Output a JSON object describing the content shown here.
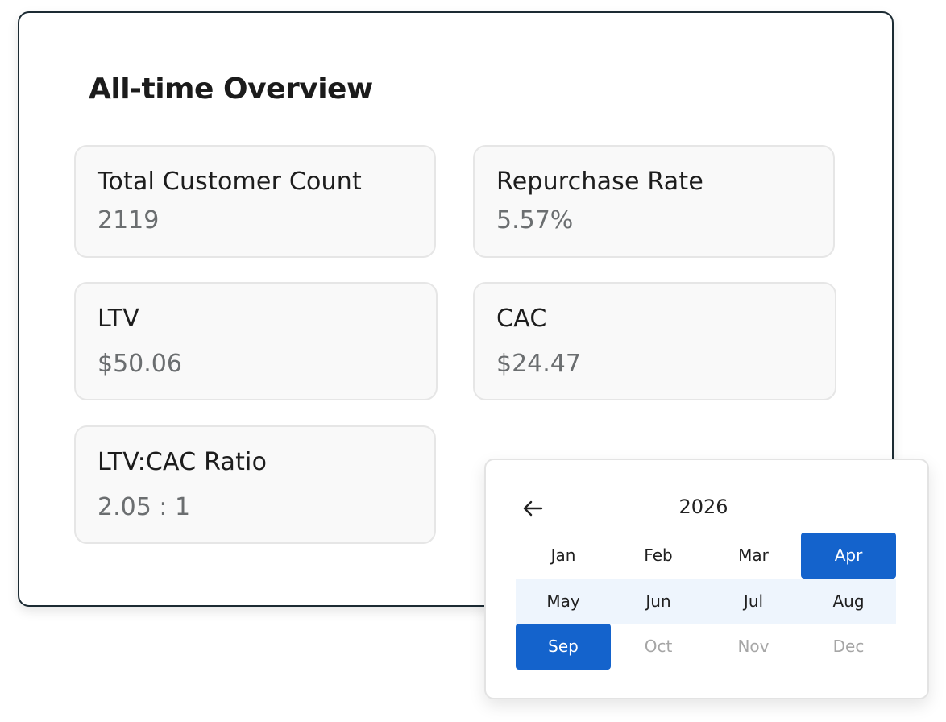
{
  "overview": {
    "title": "All-time Overview",
    "metrics": [
      {
        "label": "Total Customer Count",
        "value": "2119"
      },
      {
        "label": "Repurchase Rate",
        "value": "5.57%"
      },
      {
        "label": "LTV",
        "value": "$50.06"
      },
      {
        "label": "CAC",
        "value": "$24.47"
      },
      {
        "label": "LTV:CAC Ratio",
        "value": "2.05 : 1"
      }
    ]
  },
  "picker": {
    "back_icon": "arrow-left-icon",
    "year": "2026",
    "months": [
      {
        "label": "Jan",
        "state": "default"
      },
      {
        "label": "Feb",
        "state": "default"
      },
      {
        "label": "Mar",
        "state": "default"
      },
      {
        "label": "Apr",
        "state": "selected"
      },
      {
        "label": "May",
        "state": "in-range"
      },
      {
        "label": "Jun",
        "state": "in-range"
      },
      {
        "label": "Jul",
        "state": "in-range"
      },
      {
        "label": "Aug",
        "state": "in-range"
      },
      {
        "label": "Sep",
        "state": "selected"
      },
      {
        "label": "Oct",
        "state": "disabled"
      },
      {
        "label": "Nov",
        "state": "disabled"
      },
      {
        "label": "Dec",
        "state": "disabled"
      }
    ]
  },
  "colors": {
    "selected": "#1463cc",
    "range": "#eef5fd",
    "card_border": "#1c2b33",
    "value_text": "#6b6e70",
    "disabled_text": "#a6a6a6"
  }
}
